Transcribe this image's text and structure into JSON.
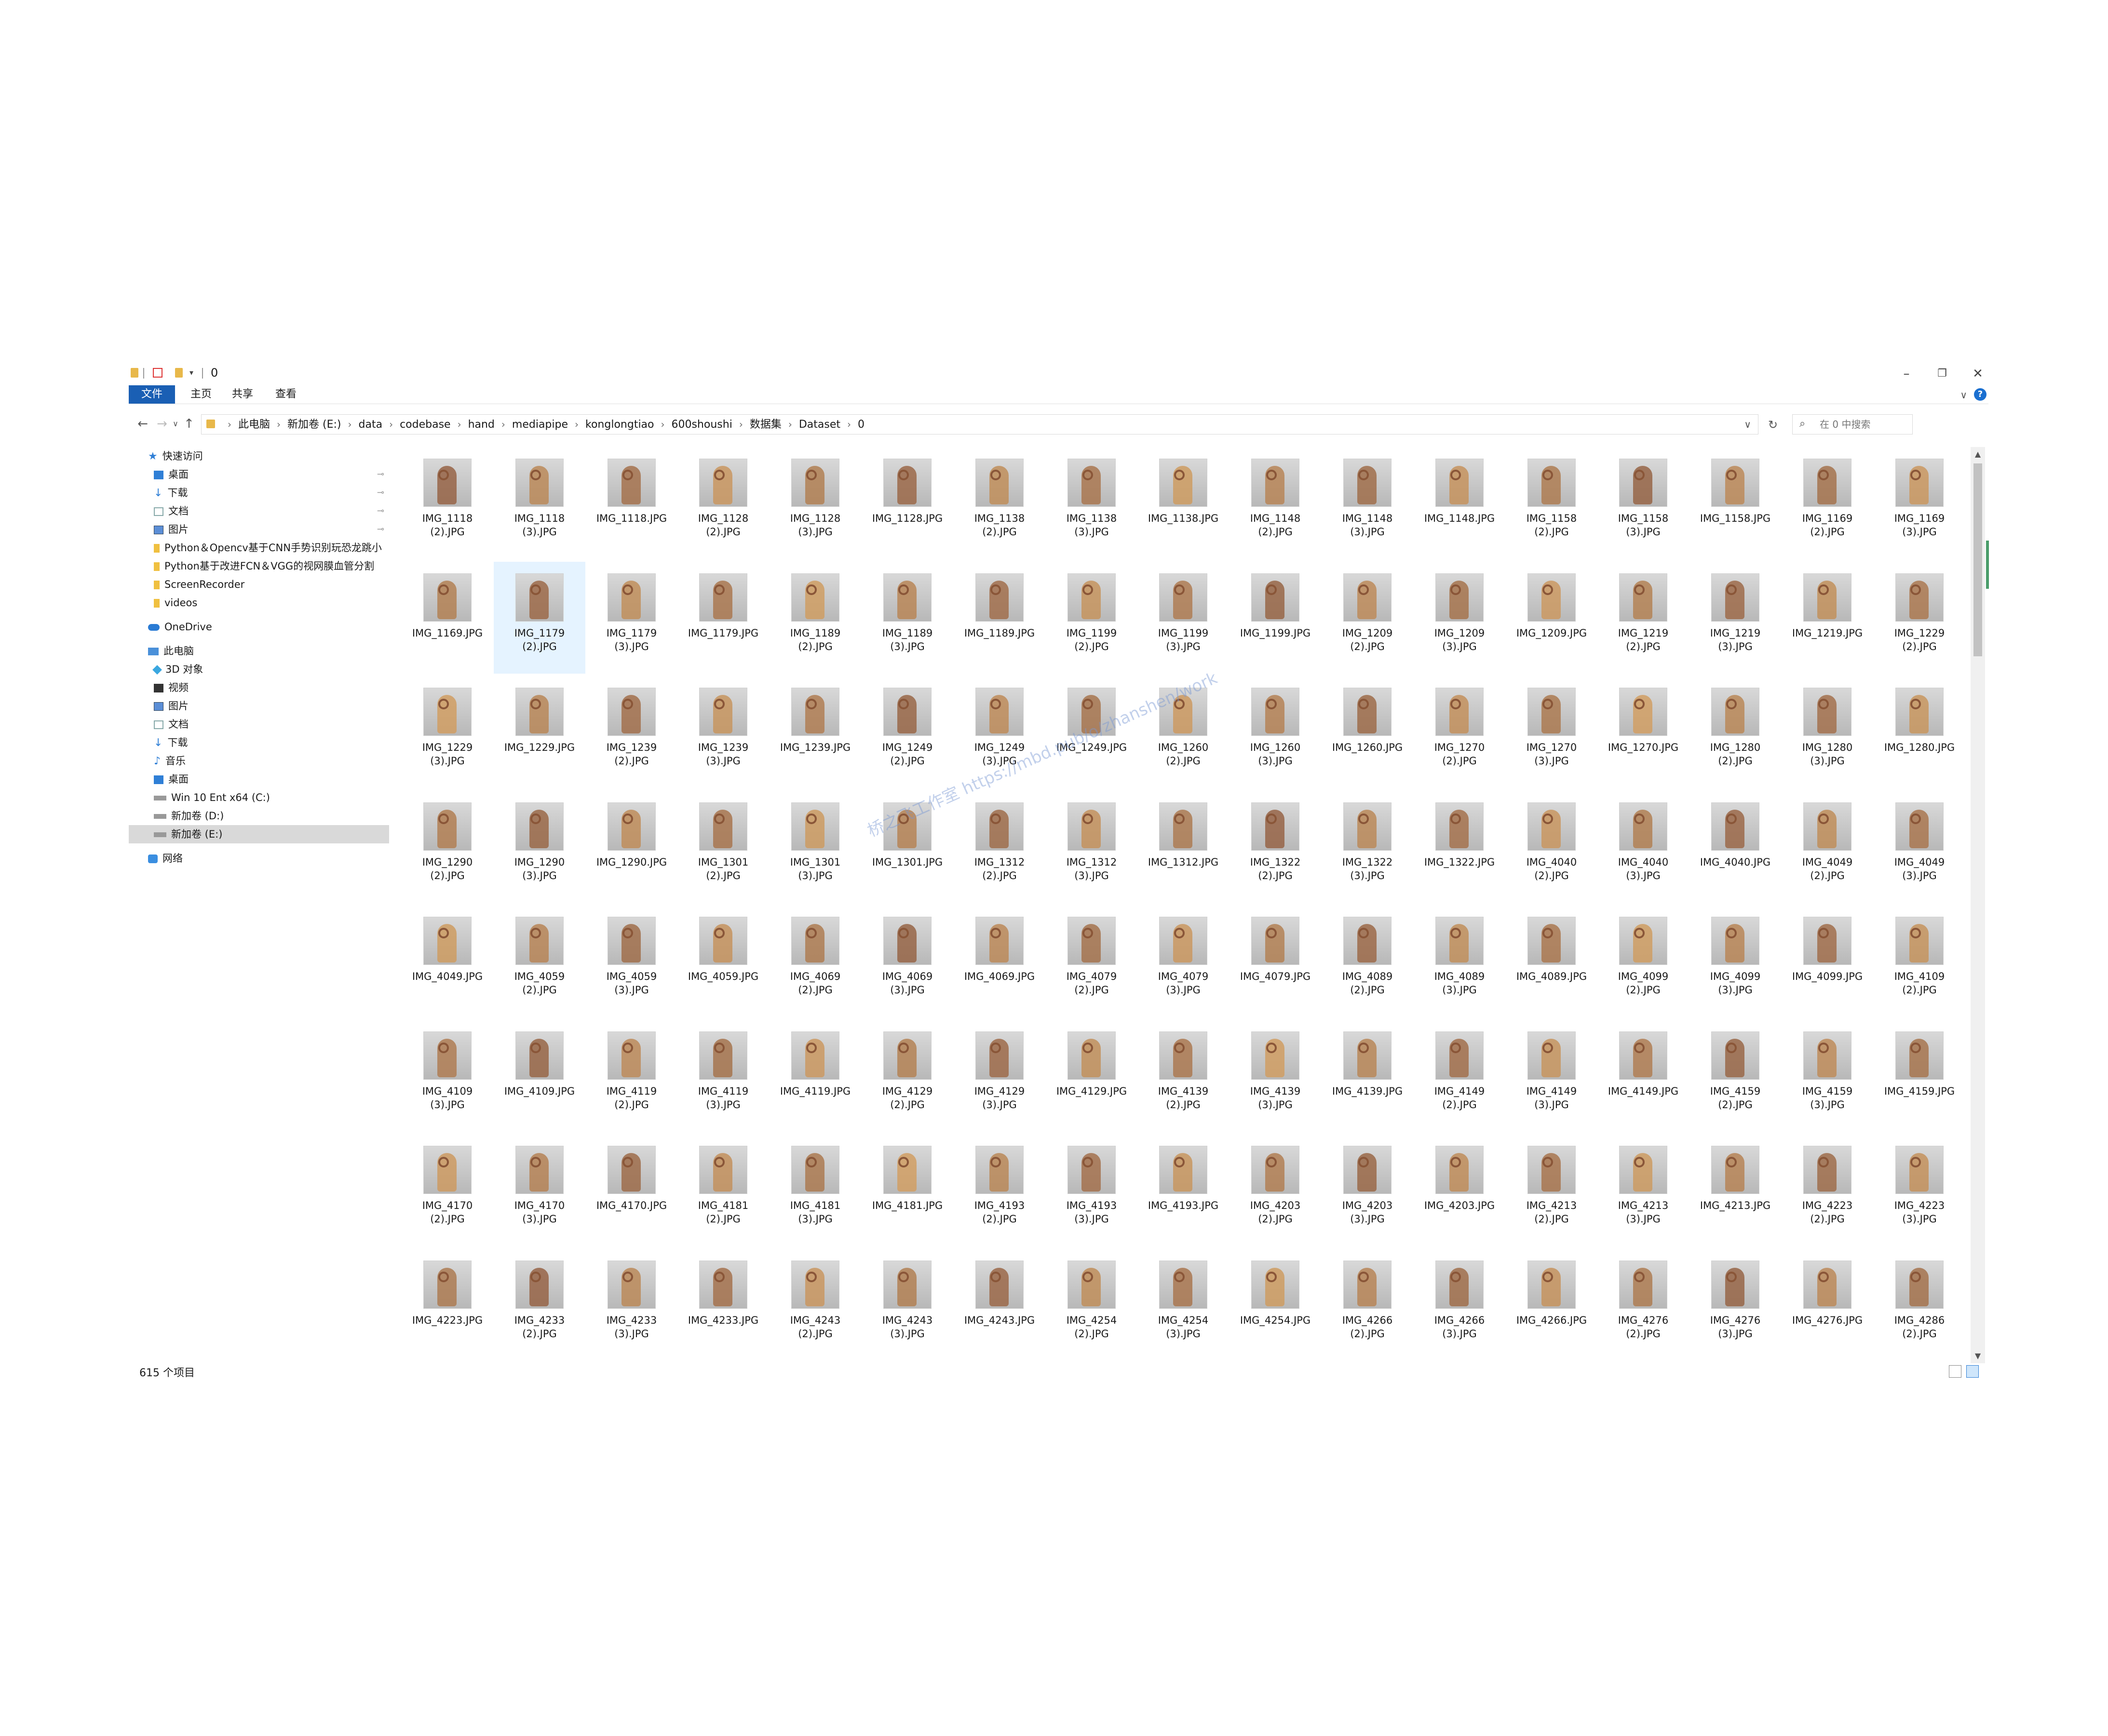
{
  "window": {
    "title": "0",
    "quick_access_toolbar": [
      "folder-icon",
      "properties-icon",
      "new-folder-icon",
      "customize-arrow"
    ],
    "controls": [
      "minimize",
      "restore",
      "close"
    ]
  },
  "ribbon": {
    "tabs": [
      "文件",
      "主页",
      "共享",
      "查看"
    ],
    "expand_glyph": "∨",
    "help_glyph": "?"
  },
  "nav_buttons": {
    "back": "←",
    "forward": "→",
    "recent": "∨",
    "up": "↑"
  },
  "address": {
    "crumbs": [
      "此电脑",
      "新加卷 (E:)",
      "data",
      "codebase",
      "hand",
      "mediapipe",
      "konglongtiao",
      "600shoushi",
      "数据集",
      "Dataset",
      "0"
    ],
    "separator": "›",
    "dropdown": "∨",
    "refresh": "↻"
  },
  "search": {
    "placeholder": "在 0 中搜索",
    "icon": "⌕"
  },
  "sidebar": {
    "items": [
      {
        "label": "快速访问",
        "icon": "star-icon",
        "glyph": "★",
        "indent": 0,
        "pinned": false
      },
      {
        "label": "桌面",
        "icon": "desktop-icon",
        "indent": 1,
        "pinned": true
      },
      {
        "label": "下载",
        "icon": "download-icon",
        "glyph": "↓",
        "indent": 1,
        "pinned": true
      },
      {
        "label": "文档",
        "icon": "document-icon",
        "indent": 1,
        "pinned": true
      },
      {
        "label": "图片",
        "icon": "picture-icon",
        "indent": 1,
        "pinned": true
      },
      {
        "label": "Python＆Opencv基于CNN手势识别玩恐龙跳小",
        "icon": "folder-icon",
        "indent": 1,
        "pinned": false
      },
      {
        "label": "Python基于改进FCN＆VGG的视网膜血管分割",
        "icon": "folder-icon",
        "indent": 1,
        "pinned": false
      },
      {
        "label": "ScreenRecorder",
        "icon": "folder-icon",
        "indent": 1,
        "pinned": false
      },
      {
        "label": "videos",
        "icon": "folder-icon",
        "indent": 1,
        "pinned": false
      },
      {
        "label": "OneDrive",
        "icon": "onedrive-icon",
        "indent": 0,
        "pinned": false
      },
      {
        "label": "此电脑",
        "icon": "this-pc-icon",
        "indent": 0,
        "pinned": false
      },
      {
        "label": "3D 对象",
        "icon": "3d-objects-icon",
        "indent": 1,
        "pinned": false
      },
      {
        "label": "视频",
        "icon": "video-icon",
        "indent": 1,
        "pinned": false
      },
      {
        "label": "图片",
        "icon": "picture-icon",
        "indent": 1,
        "pinned": false
      },
      {
        "label": "文档",
        "icon": "document-icon",
        "indent": 1,
        "pinned": false
      },
      {
        "label": "下载",
        "icon": "download-icon",
        "glyph": "↓",
        "indent": 1,
        "pinned": false
      },
      {
        "label": "音乐",
        "icon": "music-icon",
        "glyph": "♪",
        "indent": 1,
        "pinned": false
      },
      {
        "label": "桌面",
        "icon": "desktop-icon",
        "indent": 1,
        "pinned": false
      },
      {
        "label": "Win 10 Ent x64 (C:)",
        "icon": "drive-icon",
        "indent": 1,
        "pinned": false
      },
      {
        "label": "新加卷 (D:)",
        "icon": "drive-icon",
        "indent": 1,
        "pinned": false
      },
      {
        "label": "新加卷 (E:)",
        "icon": "drive-icon",
        "indent": 1,
        "pinned": false,
        "selected": true
      },
      {
        "label": "网络",
        "icon": "network-icon",
        "indent": 0,
        "pinned": false
      }
    ],
    "pin_glyph": "📌"
  },
  "files": [
    "IMG_1118\n(2).JPG",
    "IMG_1118\n(3).JPG",
    "IMG_1118.JPG",
    "IMG_1128\n(2).JPG",
    "IMG_1128\n(3).JPG",
    "IMG_1128.JPG",
    "IMG_1138\n(2).JPG",
    "IMG_1138\n(3).JPG",
    "IMG_1138.JPG",
    "IMG_1148\n(2).JPG",
    "IMG_1148\n(3).JPG",
    "IMG_1148.JPG",
    "IMG_1158\n(2).JPG",
    "IMG_1158\n(3).JPG",
    "IMG_1158.JPG",
    "IMG_1169\n(2).JPG",
    "IMG_1169\n(3).JPG",
    "IMG_1169.JPG",
    "IMG_1179\n(2).JPG",
    "IMG_1179\n(3).JPG",
    "IMG_1179.JPG",
    "IMG_1189\n(2).JPG",
    "IMG_1189\n(3).JPG",
    "IMG_1189.JPG",
    "IMG_1199\n(2).JPG",
    "IMG_1199\n(3).JPG",
    "IMG_1199.JPG",
    "IMG_1209\n(2).JPG",
    "IMG_1209\n(3).JPG",
    "IMG_1209.JPG",
    "IMG_1219\n(2).JPG",
    "IMG_1219\n(3).JPG",
    "IMG_1219.JPG",
    "IMG_1229\n(2).JPG",
    "IMG_1229\n(3).JPG",
    "IMG_1229.JPG",
    "IMG_1239\n(2).JPG",
    "IMG_1239\n(3).JPG",
    "IMG_1239.JPG",
    "IMG_1249\n(2).JPG",
    "IMG_1249\n(3).JPG",
    "IMG_1249.JPG",
    "IMG_1260\n(2).JPG",
    "IMG_1260\n(3).JPG",
    "IMG_1260.JPG",
    "IMG_1270\n(2).JPG",
    "IMG_1270\n(3).JPG",
    "IMG_1270.JPG",
    "IMG_1280\n(2).JPG",
    "IMG_1280\n(3).JPG",
    "IMG_1280.JPG",
    "IMG_1290\n(2).JPG",
    "IMG_1290\n(3).JPG",
    "IMG_1290.JPG",
    "IMG_1301\n(2).JPG",
    "IMG_1301\n(3).JPG",
    "IMG_1301.JPG",
    "IMG_1312\n(2).JPG",
    "IMG_1312\n(3).JPG",
    "IMG_1312.JPG",
    "IMG_1322\n(2).JPG",
    "IMG_1322\n(3).JPG",
    "IMG_1322.JPG",
    "IMG_4040\n(2).JPG",
    "IMG_4040\n(3).JPG",
    "IMG_4040.JPG",
    "IMG_4049\n(2).JPG",
    "IMG_4049\n(3).JPG",
    "IMG_4049.JPG",
    "IMG_4059\n(2).JPG",
    "IMG_4059\n(3).JPG",
    "IMG_4059.JPG",
    "IMG_4069\n(2).JPG",
    "IMG_4069\n(3).JPG",
    "IMG_4069.JPG",
    "IMG_4079\n(2).JPG",
    "IMG_4079\n(3).JPG",
    "IMG_4079.JPG",
    "IMG_4089\n(2).JPG",
    "IMG_4089\n(3).JPG",
    "IMG_4089.JPG",
    "IMG_4099\n(2).JPG",
    "IMG_4099\n(3).JPG",
    "IMG_4099.JPG",
    "IMG_4109\n(2).JPG",
    "IMG_4109\n(3).JPG",
    "IMG_4109.JPG",
    "IMG_4119\n(2).JPG",
    "IMG_4119\n(3).JPG",
    "IMG_4119.JPG",
    "IMG_4129\n(2).JPG",
    "IMG_4129\n(3).JPG",
    "IMG_4129.JPG",
    "IMG_4139\n(2).JPG",
    "IMG_4139\n(3).JPG",
    "IMG_4139.JPG",
    "IMG_4149\n(2).JPG",
    "IMG_4149\n(3).JPG",
    "IMG_4149.JPG",
    "IMG_4159\n(2).JPG",
    "IMG_4159\n(3).JPG",
    "IMG_4159.JPG",
    "IMG_4170\n(2).JPG",
    "IMG_4170\n(3).JPG",
    "IMG_4170.JPG",
    "IMG_4181\n(2).JPG",
    "IMG_4181\n(3).JPG",
    "IMG_4181.JPG",
    "IMG_4193\n(2).JPG",
    "IMG_4193\n(3).JPG",
    "IMG_4193.JPG",
    "IMG_4203\n(2).JPG",
    "IMG_4203\n(3).JPG",
    "IMG_4203.JPG",
    "IMG_4213\n(2).JPG",
    "IMG_4213\n(3).JPG",
    "IMG_4213.JPG",
    "IMG_4223\n(2).JPG",
    "IMG_4223\n(3).JPG",
    "IMG_4223.JPG",
    "IMG_4233\n(2).JPG",
    "IMG_4233\n(3).JPG",
    "IMG_4233.JPG",
    "IMG_4243\n(2).JPG",
    "IMG_4243\n(3).JPG",
    "IMG_4243.JPG",
    "IMG_4254\n(2).JPG",
    "IMG_4254\n(3).JPG",
    "IMG_4254.JPG",
    "IMG_4266\n(2).JPG",
    "IMG_4266\n(3).JPG",
    "IMG_4266.JPG",
    "IMG_4276\n(2).JPG",
    "IMG_4276\n(3).JPG",
    "IMG_4276.JPG",
    "IMG_4286\n(2).JPG"
  ],
  "selected_file": "IMG_1179\n(2).JPG",
  "status": {
    "item_count": "615 个项目"
  },
  "watermark": "桥之飞工作室 https://mbd.pub/o/zhanshen/work",
  "colors": {
    "accent": "#1a5fb4",
    "selection": "#e5f3ff",
    "nav_selected": "#d9d9d9"
  }
}
